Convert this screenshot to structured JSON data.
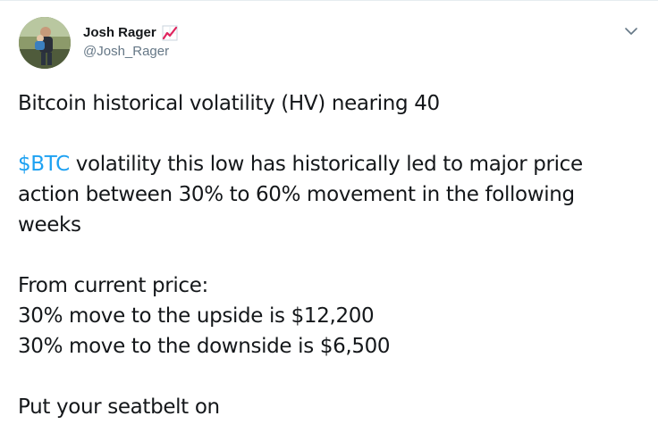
{
  "author": {
    "display_name": "Josh Rager",
    "handle": "@Josh_Rager",
    "name_emoji": "chart-increasing-emoji"
  },
  "menu": {
    "icon": "chevron-down-icon"
  },
  "tweet": {
    "line_1": "Bitcoin historical volatility (HV) nearing 40",
    "cashtag": "$BTC",
    "para_2_line_1_rest": " volatility this low has historically led to major price",
    "para_2_line_2": "action between 30% to 60% movement in the following",
    "para_2_line_3": "weeks",
    "para_3_line_1": "From current price:",
    "para_3_line_2": "30% move to the upside is $12,200",
    "para_3_line_3": "30% move to the downside is $6,500",
    "para_4_line_1": "Put your seatbelt on"
  },
  "colors": {
    "link": "#1da1f2",
    "text": "#14171a",
    "secondary": "#657786",
    "emoji_red": "#e0245e"
  }
}
